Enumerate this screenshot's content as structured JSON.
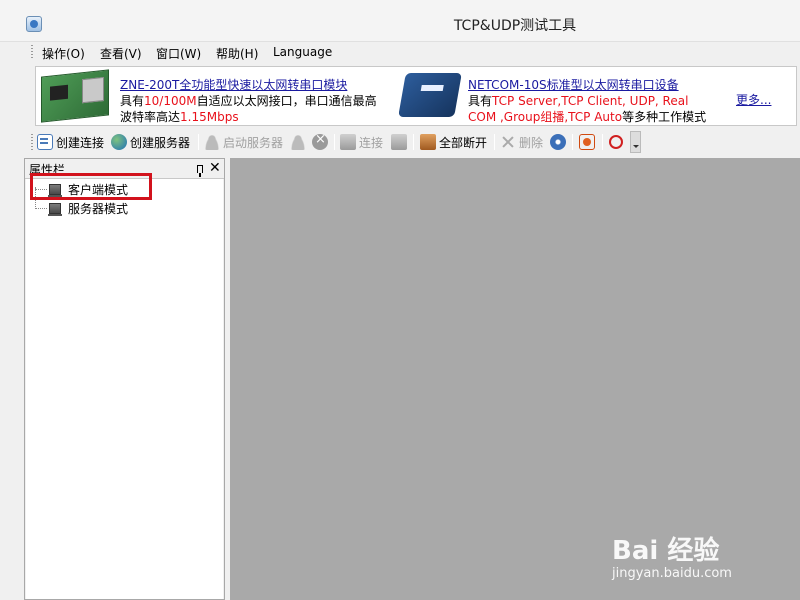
{
  "window": {
    "title": "TCP&UDP测试工具"
  },
  "menu": [
    {
      "label": "操作(O)"
    },
    {
      "label": "查看(V)"
    },
    {
      "label": "窗口(W)"
    },
    {
      "label": "帮助(H)"
    },
    {
      "label": "Language"
    }
  ],
  "banner": {
    "product1": {
      "title": "ZNE-200T全功能型快速以太网转串口模块",
      "line1_pre": "具有",
      "line1_red": "10/100M",
      "line1_post": "自适应以太网接口，串口通信最高",
      "line2_pre": "波特率高达",
      "line2_red": "1.15Mbps"
    },
    "product2": {
      "title": "NETCOM-10S标准型以太网转串口设备",
      "line1_pre": "具有",
      "line1_red": "TCP Server,TCP Client, UDP, Real",
      "line2_red": "COM ,Group组播,TCP Auto",
      "line2_post": "等多种工作模式"
    },
    "more": "更多..."
  },
  "toolbar": {
    "create_connection": "创建连接",
    "create_server": "创建服务器",
    "start_server": "启动服务器",
    "connect": "连接",
    "disconnect_all": "全部断开",
    "delete": "删除"
  },
  "panel": {
    "title": "属性栏",
    "items": [
      {
        "label": "客户端模式"
      },
      {
        "label": "服务器模式"
      }
    ]
  },
  "watermark": {
    "brand": "Bai 经验",
    "url": "jingyan.baidu.com"
  },
  "colors": {
    "highlight": "#d2121c",
    "workspace": "#a9a9a9",
    "link": "#1a1aa0",
    "accent_red": "#e8111b"
  }
}
